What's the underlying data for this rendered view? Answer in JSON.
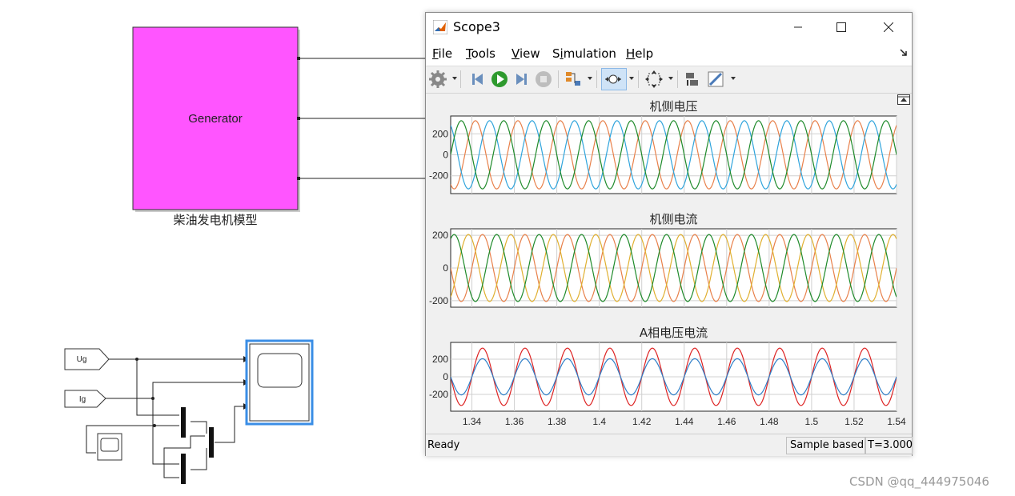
{
  "model": {
    "generator_block": {
      "label": "Generator",
      "caption": "柴油发电机模型",
      "fill": "#ff55ff"
    },
    "goto_tags": [
      "Ug",
      "Ig"
    ]
  },
  "scope_window": {
    "title": "Scope3",
    "menu": [
      {
        "key": "F",
        "rest": "ile"
      },
      {
        "key": "T",
        "rest": "ools"
      },
      {
        "key": "V",
        "rest": "iew"
      },
      {
        "pre": "S",
        "key": "i",
        "rest": "mulation"
      },
      {
        "key": "H",
        "rest": "elp"
      }
    ],
    "toolbar_icons": [
      "gear-icon",
      "step-back-icon",
      "run-icon",
      "step-forward-icon",
      "stop-icon",
      "signal-selector-icon",
      "zoom-icon",
      "fit-view-icon",
      "restore-layout-icon",
      "style-icon"
    ],
    "status": {
      "left": "Ready",
      "mode": "Sample based",
      "time": "T=3.000"
    }
  },
  "chart_data": [
    {
      "type": "line",
      "title": "机侧电压",
      "xlim": [
        1.33,
        1.54
      ],
      "ylim": [
        -370,
        370
      ],
      "yticks": [
        200,
        0,
        -200
      ],
      "grid": true,
      "frequency_hz": 50,
      "series": [
        {
          "amplitude": 325,
          "phase_deg": 60,
          "color": "#e8804a"
        },
        {
          "amplitude": 325,
          "phase_deg": -60,
          "color": "#2fa4dc"
        },
        {
          "amplitude": 325,
          "phase_deg": 180,
          "color": "#1e8a2a"
        }
      ]
    },
    {
      "type": "line",
      "title": "机侧电流",
      "xlim": [
        1.33,
        1.54
      ],
      "ylim": [
        -240,
        240
      ],
      "yticks": [
        200,
        0,
        -200
      ],
      "grid": true,
      "frequency_hz": 50,
      "series": [
        {
          "amplitude": 205,
          "phase_deg": 0,
          "color": "#e8804a"
        },
        {
          "amplitude": 205,
          "phase_deg": 120,
          "color": "#e0b030"
        },
        {
          "amplitude": 205,
          "phase_deg": -120,
          "color": "#1e8a2a"
        }
      ]
    },
    {
      "type": "line",
      "title": "A相电压电流",
      "xlim": [
        1.33,
        1.54
      ],
      "xticks": [
        1.34,
        1.36,
        1.38,
        1.4,
        1.42,
        1.44,
        1.46,
        1.48,
        1.5,
        1.52,
        1.54
      ],
      "ylim": [
        -390,
        390
      ],
      "yticks": [
        200,
        0,
        -200
      ],
      "grid": true,
      "frequency_hz": 50,
      "series": [
        {
          "amplitude": 325,
          "phase_deg": 0,
          "color": "#dd2222"
        },
        {
          "amplitude": 205,
          "phase_deg": 0,
          "color": "#2f7fc8"
        }
      ]
    }
  ],
  "watermark": "CSDN @qq_444975046"
}
